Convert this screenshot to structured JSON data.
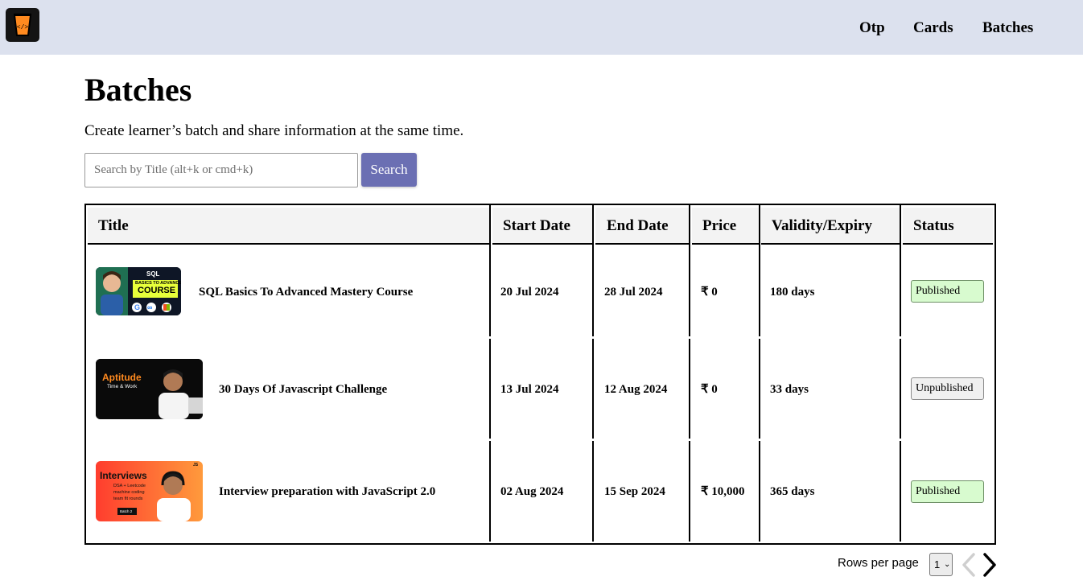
{
  "nav": {
    "items": [
      "Otp",
      "Cards",
      "Batches"
    ]
  },
  "page": {
    "title": "Batches",
    "subtitle": "Create learner’s batch and share information at the same time."
  },
  "search": {
    "placeholder": "Search by Title (alt+k or cmd+k)",
    "value": "",
    "button_label": "Search"
  },
  "table": {
    "headers": [
      "Title",
      "Start Date",
      "End Date",
      "Price",
      "Validity/Expiry",
      "Status"
    ],
    "rows": [
      {
        "thumb_text": {
          "line1": "SQL",
          "line2": "BASICS TO ADVANCED",
          "line3": "COURSE"
        },
        "title": "SQL Basics To Advanced Mastery Course",
        "start": "20 Jul 2024",
        "end": "28 Jul 2024",
        "price": "₹ 0",
        "validity": "180 days",
        "status": "Published"
      },
      {
        "thumb_text": {
          "line1": "Aptitude",
          "line2": "Time & Work"
        },
        "title": "30 Days Of Javascript Challenge",
        "start": "13 Jul 2024",
        "end": "12 Aug 2024",
        "price": "₹ 0",
        "validity": "33 days",
        "status": "Unpublished"
      },
      {
        "thumb_text": {
          "line1": "Interviews",
          "line2": "DSA + Leetcode",
          "line3": "machine coding",
          "line4": "team fit rounds",
          "line5": "Batch 2",
          "corner": "JS"
        },
        "title": "Interview preparation with JavaScript 2.0",
        "start": "02 Aug 2024",
        "end": "15 Sep 2024",
        "price": "₹ 10,000",
        "validity": "365 days",
        "status": "Published"
      }
    ]
  },
  "pagination": {
    "rows_per_page_label": "Rows per page",
    "rows_per_page_value": "1"
  },
  "colors": {
    "topbar": "#dce1ee",
    "search_button": "#6b6fb3",
    "published_bg": "#d8fbcf",
    "unpublished_bg": "#f0f0f0",
    "header_bg": "#f3f3f3"
  },
  "icons": {
    "logo": "brand-cup-icon",
    "thumbnail_logos": [
      "google-icon",
      "meta-icon",
      "microsoft-icon"
    ],
    "select_arrow": "chevron-down-icon",
    "prev": "chevron-left-icon",
    "next": "chevron-right-icon"
  }
}
